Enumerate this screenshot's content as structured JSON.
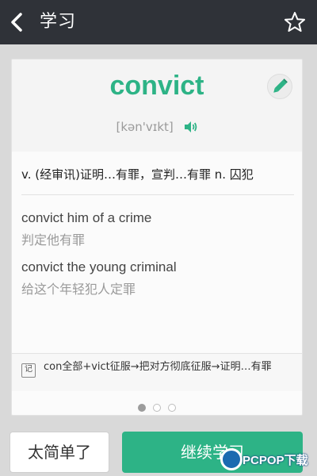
{
  "header": {
    "title": "学习",
    "back_icon": "chevron-left-icon",
    "favorite_icon": "star-icon"
  },
  "word": {
    "headword": "convict",
    "phonetic": "[kən'vɪkt]",
    "edit_icon": "pencil-icon",
    "audio_icon": "speaker-icon",
    "definition": "v. (经审讯)证明…有罪，宣判…有罪  n. 囚犯"
  },
  "examples": [
    {
      "en": "convict him of a crime",
      "zh": "判定他有罪"
    },
    {
      "en": "convict the young criminal",
      "zh": "给这个年轻犯人定罪"
    }
  ],
  "etymology": {
    "icon_label": "记",
    "text": "con全部+vict征服→把对方彻底征服→证明…有罪"
  },
  "pager": {
    "total": 3,
    "active": 1
  },
  "actions": {
    "easy_label": "太简单了",
    "continue_label": "继续学习"
  },
  "watermark": {
    "text": "PCPOP下载"
  },
  "colors": {
    "accent": "#2db386",
    "topbar": "#2f3238",
    "background": "#d9d9d9"
  }
}
